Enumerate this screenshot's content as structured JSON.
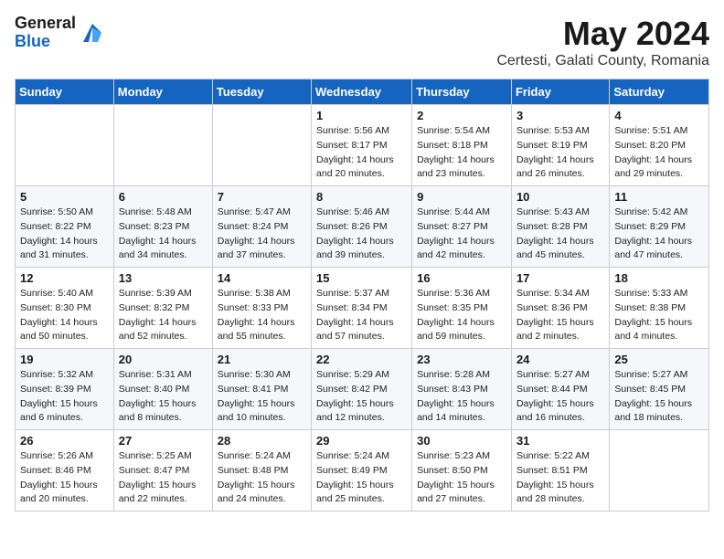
{
  "header": {
    "logo_general": "General",
    "logo_blue": "Blue",
    "month_year": "May 2024",
    "location": "Certesti, Galati County, Romania"
  },
  "weekdays": [
    "Sunday",
    "Monday",
    "Tuesday",
    "Wednesday",
    "Thursday",
    "Friday",
    "Saturday"
  ],
  "weeks": [
    [
      {
        "day": "",
        "info": ""
      },
      {
        "day": "",
        "info": ""
      },
      {
        "day": "",
        "info": ""
      },
      {
        "day": "1",
        "info": "Sunrise: 5:56 AM\nSunset: 8:17 PM\nDaylight: 14 hours\nand 20 minutes."
      },
      {
        "day": "2",
        "info": "Sunrise: 5:54 AM\nSunset: 8:18 PM\nDaylight: 14 hours\nand 23 minutes."
      },
      {
        "day": "3",
        "info": "Sunrise: 5:53 AM\nSunset: 8:19 PM\nDaylight: 14 hours\nand 26 minutes."
      },
      {
        "day": "4",
        "info": "Sunrise: 5:51 AM\nSunset: 8:20 PM\nDaylight: 14 hours\nand 29 minutes."
      }
    ],
    [
      {
        "day": "5",
        "info": "Sunrise: 5:50 AM\nSunset: 8:22 PM\nDaylight: 14 hours\nand 31 minutes."
      },
      {
        "day": "6",
        "info": "Sunrise: 5:48 AM\nSunset: 8:23 PM\nDaylight: 14 hours\nand 34 minutes."
      },
      {
        "day": "7",
        "info": "Sunrise: 5:47 AM\nSunset: 8:24 PM\nDaylight: 14 hours\nand 37 minutes."
      },
      {
        "day": "8",
        "info": "Sunrise: 5:46 AM\nSunset: 8:26 PM\nDaylight: 14 hours\nand 39 minutes."
      },
      {
        "day": "9",
        "info": "Sunrise: 5:44 AM\nSunset: 8:27 PM\nDaylight: 14 hours\nand 42 minutes."
      },
      {
        "day": "10",
        "info": "Sunrise: 5:43 AM\nSunset: 8:28 PM\nDaylight: 14 hours\nand 45 minutes."
      },
      {
        "day": "11",
        "info": "Sunrise: 5:42 AM\nSunset: 8:29 PM\nDaylight: 14 hours\nand 47 minutes."
      }
    ],
    [
      {
        "day": "12",
        "info": "Sunrise: 5:40 AM\nSunset: 8:30 PM\nDaylight: 14 hours\nand 50 minutes."
      },
      {
        "day": "13",
        "info": "Sunrise: 5:39 AM\nSunset: 8:32 PM\nDaylight: 14 hours\nand 52 minutes."
      },
      {
        "day": "14",
        "info": "Sunrise: 5:38 AM\nSunset: 8:33 PM\nDaylight: 14 hours\nand 55 minutes."
      },
      {
        "day": "15",
        "info": "Sunrise: 5:37 AM\nSunset: 8:34 PM\nDaylight: 14 hours\nand 57 minutes."
      },
      {
        "day": "16",
        "info": "Sunrise: 5:36 AM\nSunset: 8:35 PM\nDaylight: 14 hours\nand 59 minutes."
      },
      {
        "day": "17",
        "info": "Sunrise: 5:34 AM\nSunset: 8:36 PM\nDaylight: 15 hours\nand 2 minutes."
      },
      {
        "day": "18",
        "info": "Sunrise: 5:33 AM\nSunset: 8:38 PM\nDaylight: 15 hours\nand 4 minutes."
      }
    ],
    [
      {
        "day": "19",
        "info": "Sunrise: 5:32 AM\nSunset: 8:39 PM\nDaylight: 15 hours\nand 6 minutes."
      },
      {
        "day": "20",
        "info": "Sunrise: 5:31 AM\nSunset: 8:40 PM\nDaylight: 15 hours\nand 8 minutes."
      },
      {
        "day": "21",
        "info": "Sunrise: 5:30 AM\nSunset: 8:41 PM\nDaylight: 15 hours\nand 10 minutes."
      },
      {
        "day": "22",
        "info": "Sunrise: 5:29 AM\nSunset: 8:42 PM\nDaylight: 15 hours\nand 12 minutes."
      },
      {
        "day": "23",
        "info": "Sunrise: 5:28 AM\nSunset: 8:43 PM\nDaylight: 15 hours\nand 14 minutes."
      },
      {
        "day": "24",
        "info": "Sunrise: 5:27 AM\nSunset: 8:44 PM\nDaylight: 15 hours\nand 16 minutes."
      },
      {
        "day": "25",
        "info": "Sunrise: 5:27 AM\nSunset: 8:45 PM\nDaylight: 15 hours\nand 18 minutes."
      }
    ],
    [
      {
        "day": "26",
        "info": "Sunrise: 5:26 AM\nSunset: 8:46 PM\nDaylight: 15 hours\nand 20 minutes."
      },
      {
        "day": "27",
        "info": "Sunrise: 5:25 AM\nSunset: 8:47 PM\nDaylight: 15 hours\nand 22 minutes."
      },
      {
        "day": "28",
        "info": "Sunrise: 5:24 AM\nSunset: 8:48 PM\nDaylight: 15 hours\nand 24 minutes."
      },
      {
        "day": "29",
        "info": "Sunrise: 5:24 AM\nSunset: 8:49 PM\nDaylight: 15 hours\nand 25 minutes."
      },
      {
        "day": "30",
        "info": "Sunrise: 5:23 AM\nSunset: 8:50 PM\nDaylight: 15 hours\nand 27 minutes."
      },
      {
        "day": "31",
        "info": "Sunrise: 5:22 AM\nSunset: 8:51 PM\nDaylight: 15 hours\nand 28 minutes."
      },
      {
        "day": "",
        "info": ""
      }
    ]
  ]
}
